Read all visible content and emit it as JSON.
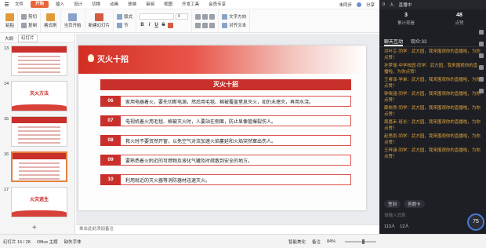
{
  "menubar": {
    "items": [
      "文件",
      "开始",
      "插入",
      "设计",
      "切换",
      "动画",
      "放映",
      "审阅",
      "视图",
      "开发工具",
      "会员专享"
    ],
    "active_index": 1,
    "right_text": "未同步",
    "share_label": "分享"
  },
  "ribbon": {
    "paste_label": "粘贴",
    "cut_label": "剪切",
    "copy_label": "复制",
    "format_painter_label": "格式刷",
    "from_current_label": "当页开始",
    "new_slide_label": "新建幻灯片",
    "layout_label": "版式",
    "section_label": "节",
    "reset_label": "重置",
    "font_name": "",
    "font_size": "0",
    "bold": "B",
    "italic": "I",
    "underline": "U",
    "strike": "S",
    "textbox_label": "文本框",
    "shape_label": "形状",
    "arrange_label": "排列",
    "auto_number_label": "文字方向",
    "align_text_label": "对齐文本",
    "smartart_label": "转换成图示"
  },
  "leftpanel": {
    "tab_outline": "大纲",
    "tab_slides": "幻灯片",
    "slides": [
      {
        "num": "13",
        "kind": "list",
        "title": ""
      },
      {
        "num": "14",
        "kind": "title",
        "title": "灭火方法"
      },
      {
        "num": "15",
        "kind": "list",
        "title": ""
      },
      {
        "num": "16",
        "kind": "list",
        "title": ""
      },
      {
        "num": "17",
        "kind": "title",
        "title": "火灾逃生"
      }
    ],
    "selected_index": 3
  },
  "slide": {
    "title": "灭火十招",
    "header": "灭火十招",
    "rules": [
      {
        "num": "06",
        "text": "家用电器着火，要先切断电源，然后用毛毯、棉被覆盖窒息灭火，如仍未熄灭，再用水浇。"
      },
      {
        "num": "07",
        "text": "电视机着火用毛毯、棉被灭火时，人要站在侧面，防止显像管爆裂伤人。"
      },
      {
        "num": "08",
        "text": "救火时不要贸然开窗，以免空气对流加速火焰蔓延和火焰突然窜出伤人。"
      },
      {
        "num": "09",
        "text": "要熟悉着火附近的可燃物及液化气罐及时疏散到安全的地方。"
      },
      {
        "num": "10",
        "text": "利用就近的灭火器等消防器材迅速灭火。"
      }
    ]
  },
  "notes": {
    "placeholder": "单击此处添加备注"
  },
  "statusbar": {
    "slide_count": "幻灯片 16 / 28",
    "theme": "Office 主题",
    "missing_font": "缺失字体",
    "smart_beautify": "智能美化",
    "notes_label": "备注",
    "zoom": "84%"
  },
  "live": {
    "topline": [
      "0",
      "人",
      "直播中"
    ],
    "stats": [
      {
        "value": "3",
        "label": "累计观看"
      },
      {
        "value": "48",
        "label": "点赞"
      }
    ],
    "tabs": [
      "聊天互动",
      "观众:33"
    ],
    "messages": [
      "洪叶芷·同学：武方园，我来围观你的直播啦，为你点赞！",
      "孙梦瑶·中学校园·同学：武方园，我来围观你的直播啦，为你点赞！",
      "王睿泽·学弟：武方园，我来围观你的直播啦，为你点赞！",
      "钟晓涵·同学：武方园，我来围观你的直播啦，为你点赞！",
      "薛依然·同学：武方园，我来围观你的直播啦，为你点赞！",
      "周嘉禾·班长：武方园，我来围观你的直播啦，为你点赞！",
      "赵思雨·同学：武方园，我来围观你的直播啦，为你点赞！",
      "王梓涵·同学：武方园，我来围观你的直播啦，为你点赞！"
    ],
    "actions": [
      "签到",
      "答题卡"
    ],
    "input_placeholder": "请输入消息",
    "footer": [
      "113人",
      "12人"
    ],
    "badge": "75"
  }
}
